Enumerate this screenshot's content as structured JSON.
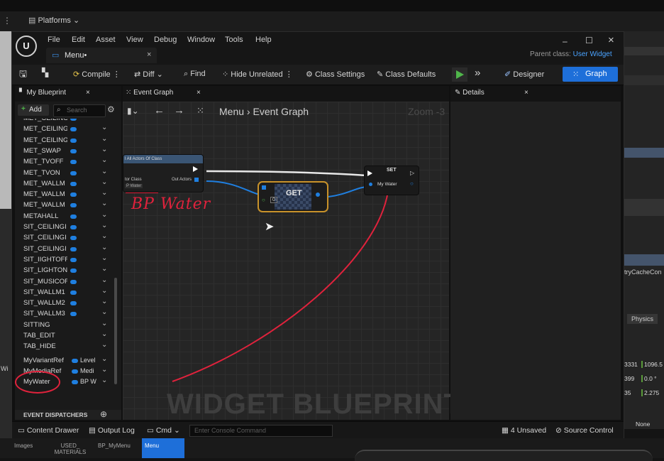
{
  "background": {
    "platforms_label": "Platforms",
    "right_panel": {
      "cache_text": "tryCacheCon",
      "physics_button": "Physics",
      "values": [
        "3331",
        "1096.5",
        "399",
        "0.0 °",
        "35",
        "2.275"
      ],
      "none_label": "None"
    },
    "left_strip_text": "Wi"
  },
  "window": {
    "menu": [
      "File",
      "Edit",
      "Asset",
      "View",
      "Debug",
      "Window",
      "Tools",
      "Help"
    ],
    "tab_title": "Menu•",
    "parent_class_label": "Parent class:",
    "parent_class_value": "User Widget"
  },
  "toolbar": {
    "compile": "Compile",
    "diff": "Diff",
    "find": "Find",
    "hide_unrelated": "Hide Unrelated",
    "class_settings": "Class Settings",
    "class_defaults": "Class Defaults",
    "designer": "Designer",
    "graph": "Graph"
  },
  "my_blueprint": {
    "tab": "My Blueprint",
    "add": "Add",
    "search_placeholder": "Search",
    "variables": [
      {
        "name": "MET_CEILING",
        "type": ""
      },
      {
        "name": "MET_CEILING",
        "type": ""
      },
      {
        "name": "MET_CEILING",
        "type": ""
      },
      {
        "name": "MET_SWAP",
        "type": ""
      },
      {
        "name": "MET_TVOFF",
        "type": ""
      },
      {
        "name": "MET_TVON",
        "type": ""
      },
      {
        "name": "MET_WALLM",
        "type": ""
      },
      {
        "name": "MET_WALLM",
        "type": ""
      },
      {
        "name": "MET_WALLM",
        "type": ""
      },
      {
        "name": "METAHALL",
        "type": ""
      },
      {
        "name": "SIT_CEILINGI",
        "type": ""
      },
      {
        "name": "SIT_CEILINGI",
        "type": ""
      },
      {
        "name": "SIT_CEILINGI",
        "type": ""
      },
      {
        "name": "SIT_IIGHTOFF",
        "type": ""
      },
      {
        "name": "SIT_LIGHTON",
        "type": ""
      },
      {
        "name": "SIT_MUSICOF",
        "type": ""
      },
      {
        "name": "SIT_WALLM1",
        "type": ""
      },
      {
        "name": "SIT_WALLM2",
        "type": ""
      },
      {
        "name": "SIT_WALLM3",
        "type": ""
      },
      {
        "name": "SITTING",
        "type": ""
      },
      {
        "name": "TAB_EDIT",
        "type": ""
      },
      {
        "name": "TAB_HIDE",
        "type": ""
      },
      {
        "name": "MyVariantRef",
        "type": "Level"
      },
      {
        "name": "MyMediaRef",
        "type": "Medi"
      },
      {
        "name": "MyWater",
        "type": "BP W"
      }
    ],
    "event_dispatchers": "EVENT DISPATCHERS"
  },
  "graph": {
    "tab": "Event Graph",
    "breadcrumb_root": "Menu",
    "breadcrumb_leaf": "Event Graph",
    "zoom": "Zoom -3",
    "watermark": "WIDGET BLUEPRINT",
    "annotation": "BP Water",
    "nodes": {
      "get_all": {
        "title": "l All Actors Of Class",
        "actor_class": "tor Class",
        "out_actors": "Out Actors",
        "class_value": "P Water"
      },
      "get": {
        "title": "GET",
        "index": "0"
      },
      "set": {
        "title": "SET",
        "pin": "My Water"
      }
    }
  },
  "details": {
    "tab": "Details"
  },
  "statusbar": {
    "content_drawer": "Content Drawer",
    "output_log": "Output Log",
    "cmd": "Cmd",
    "console_placeholder": "Enter Console Command",
    "unsaved": "4 Unsaved",
    "source_control": "Source Control"
  },
  "bottom_tabs": [
    "Images",
    "USED_ MATERIALS",
    "BP_MyMenu",
    "Menu"
  ],
  "colors": {
    "accent_blue": "#1e6fd9",
    "pin_blue": "#1f7fe0",
    "annotation_red": "#e0223c",
    "get_node_border": "#c8922a",
    "play_green": "#4fb64a"
  }
}
